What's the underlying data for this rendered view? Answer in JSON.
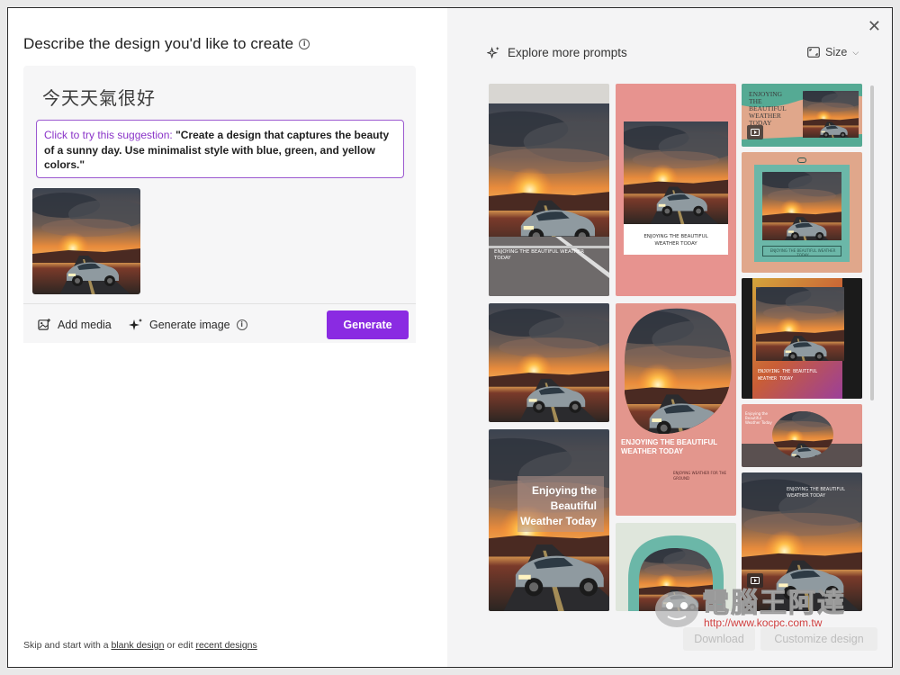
{
  "left": {
    "title": "Describe the design you'd like to create",
    "prompt_text": "今天天氣很好",
    "suggestion_lead": "Click to try this suggestion:",
    "suggestion_body": "\"Create a design that captures the beauty of a sunny day. Use minimalist style with blue, green, and yellow colors.\"",
    "add_media_label": "Add media",
    "generate_image_label": "Generate image",
    "generate_button_label": "Generate"
  },
  "footer": {
    "prefix": "Skip and start with a",
    "blank_link": "blank design",
    "middle": "or edit",
    "recent_link": "recent designs"
  },
  "right": {
    "explore_label": "Explore more prompts",
    "size_label": "Size",
    "download_label": "Download",
    "customize_label": "Customize design",
    "cards": {
      "c1_caption": "ENJOYING THE BEAUTIFUL WEATHER TODAY",
      "c2_caption_line1": "ENJOYING THE BEAUTIFUL",
      "c2_caption_line2": "WEATHER TODAY",
      "c3_caption_line1": "ENJOYING",
      "c3_caption_line2": "THE",
      "c3_caption_line3": "BEAUTIFUL",
      "c3_caption_line4": "WEATHER",
      "c3_caption_line5": "TODAY",
      "c5_caption_line1": "ENJOYING THE BEAUTIFUL",
      "c5_caption_line2": "WEATHER TODAY",
      "c6_caption_line1": "Enjoying the",
      "c6_caption_line2": "Beautiful",
      "c6_caption_line3": "Weather Today",
      "c7_caption_line1": "ENJOYING THE BEAUTIFUL",
      "c7_caption_line2": "WEATHER TODAY",
      "c7_sub": "ENJOYING WEATHER FOR THE GROUND"
    },
    "watermark_text": "電腦王阿達",
    "watermark_url": "http://www.kocpc.com.tw"
  },
  "colors": {
    "accent": "#8a2be2",
    "suggestion_border": "#9b59d0",
    "suggestion_lead": "#8a34c8",
    "card_pink": "#e7938f",
    "card_salmon": "#e0a78b",
    "card_teal": "#6bb7a8",
    "card_mint": "#dfe6dc"
  },
  "icons": {
    "info": "info-circle-icon",
    "add_media": "image-add-icon",
    "generate_image": "sparkle-icon",
    "explore": "sparkle-icon",
    "size": "aspect-ratio-icon",
    "close": "close-icon",
    "video": "video-play-icon"
  }
}
